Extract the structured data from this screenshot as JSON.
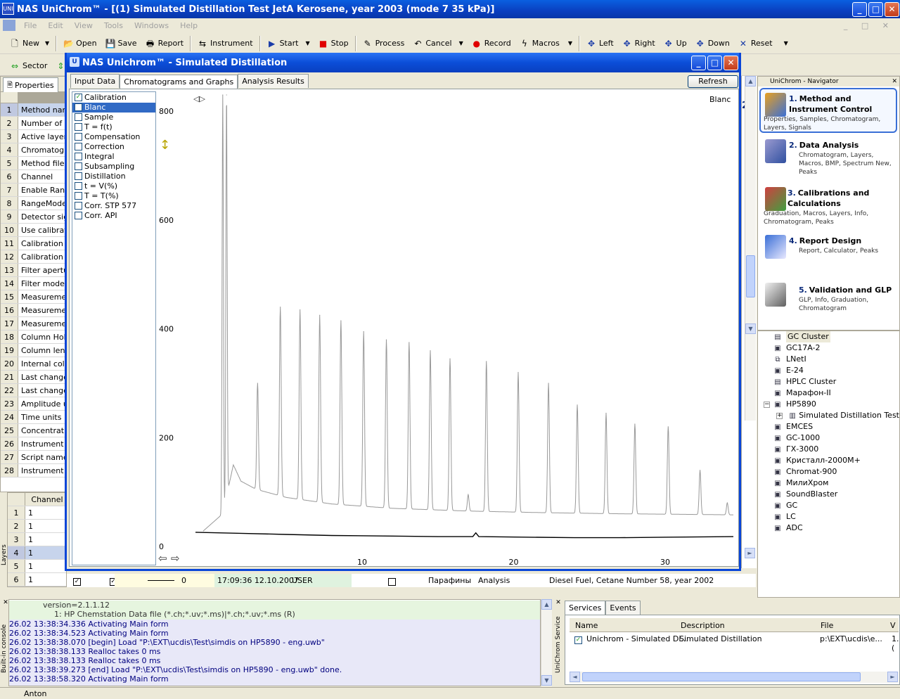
{
  "window": {
    "title": "NAS UniChrom™ - [(1) Simulated Distillation Test JetA Kerosene, year 2003 (mode 7 35 kPa)]",
    "icon_text": "UNI"
  },
  "menu": [
    "File",
    "Edit",
    "View",
    "Tools",
    "Windows",
    "Help"
  ],
  "toolbar1": {
    "new": "New",
    "open": "Open",
    "save": "Save",
    "report": "Report",
    "instrument": "Instrument",
    "start": "Start",
    "stop": "Stop",
    "process": "Process",
    "cancel": "Cancel",
    "record": "Record",
    "macros": "Macros",
    "left": "Left",
    "right": "Right",
    "up": "Up",
    "down": "Down",
    "reset": "Reset"
  },
  "toolbar2": {
    "sector": "Sector"
  },
  "properties": {
    "tab": "Properties",
    "rows": [
      {
        "n": "1",
        "label": "Method name"
      },
      {
        "n": "2",
        "label": "Number of la"
      },
      {
        "n": "3",
        "label": "Active layer"
      },
      {
        "n": "4",
        "label": "Chromatogra"
      },
      {
        "n": "5",
        "label": "Method file n"
      },
      {
        "n": "6",
        "label": "Channel"
      },
      {
        "n": "7",
        "label": "Enable Rang"
      },
      {
        "n": "8",
        "label": "RangeMode"
      },
      {
        "n": "9",
        "label": "Detector sign"
      },
      {
        "n": "10",
        "label": "Use calibrati"
      },
      {
        "n": "11",
        "label": "Calibration fa"
      },
      {
        "n": "12",
        "label": "Calibration fa"
      },
      {
        "n": "13",
        "label": "Filter apertur"
      },
      {
        "n": "14",
        "label": "Filter mode"
      },
      {
        "n": "15",
        "label": "Measuremen"
      },
      {
        "n": "16",
        "label": "Measuremen"
      },
      {
        "n": "17",
        "label": "Measuremen"
      },
      {
        "n": "18",
        "label": "Column Holde"
      },
      {
        "n": "19",
        "label": "Column lengt"
      },
      {
        "n": "20",
        "label": "Internal colur"
      },
      {
        "n": "21",
        "label": "Last change"
      },
      {
        "n": "22",
        "label": "Last change"
      },
      {
        "n": "23",
        "label": "Amplitude ur"
      },
      {
        "n": "24",
        "label": "Time units"
      },
      {
        "n": "25",
        "label": "Concentratio"
      },
      {
        "n": "26",
        "label": "Instrument"
      },
      {
        "n": "27",
        "label": "Script name"
      },
      {
        "n": "28",
        "label": "Instrument"
      }
    ]
  },
  "layers": {
    "side_label": "Layers",
    "header": "Channel",
    "rows": [
      {
        "n": "1",
        "v": "1"
      },
      {
        "n": "2",
        "v": "1"
      },
      {
        "n": "3",
        "v": "1"
      },
      {
        "n": "4",
        "v": "1"
      },
      {
        "n": "5",
        "v": "1"
      },
      {
        "n": "6",
        "v": "1"
      }
    ],
    "row6": {
      "value": "0",
      "datetime": "17:09:36 12.10.2007",
      "user": "USER",
      "name": "Парафины",
      "type": "Analysis",
      "description": "Diesel Fuel, Cetane Number 58, year 2002"
    }
  },
  "dialog": {
    "title": "NAS Unichrom™ - Simulated Distillation",
    "tabs": [
      "Input Data",
      "Chromatograms and Graphs",
      "Analysis Results"
    ],
    "refresh": "Refresh",
    "list": [
      {
        "label": "Calibration",
        "checked": true
      },
      {
        "label": "Blanc",
        "checked": false
      },
      {
        "label": "Sample",
        "checked": false
      },
      {
        "label": "T = f(t)",
        "checked": false
      },
      {
        "label": "Compensation",
        "checked": false
      },
      {
        "label": "Correction",
        "checked": false
      },
      {
        "label": "Integral",
        "checked": false
      },
      {
        "label": "Subsampling",
        "checked": false
      },
      {
        "label": "Distillation",
        "checked": false
      },
      {
        "label": "t  = V(%)",
        "checked": false
      },
      {
        "label": "T = T(%)",
        "checked": false
      },
      {
        "label": "Corr. STP 577",
        "checked": false
      },
      {
        "label": "Corr. API",
        "checked": false
      }
    ]
  },
  "chart_data": {
    "type": "line",
    "title": "",
    "legend": "Blanc",
    "xlabel": "",
    "ylabel": "",
    "xlim": [
      -1,
      34.5
    ],
    "ylim": [
      0,
      830
    ],
    "x_ticks": [
      10,
      20,
      30
    ],
    "y_ticks": [
      0,
      200,
      400,
      600,
      800
    ],
    "colors": {
      "calibration": "#999999",
      "baseline": "#000000"
    },
    "series": [
      {
        "name": "",
        "style": "calibration",
        "baseline": [
          [
            -0.5,
            28
          ],
          [
            0.8,
            60
          ],
          [
            1.5,
            150
          ],
          [
            2,
            120
          ],
          [
            3,
            105
          ],
          [
            5,
            90
          ],
          [
            8,
            78
          ],
          [
            12,
            70
          ],
          [
            17,
            65
          ],
          [
            22,
            62
          ],
          [
            27,
            60
          ],
          [
            31,
            59
          ],
          [
            34.5,
            58
          ]
        ],
        "peaks": [
          [
            0.8,
            830
          ],
          [
            1.05,
            830
          ],
          [
            3.1,
            300
          ],
          [
            4.6,
            440
          ],
          [
            5.9,
            435
          ],
          [
            7.2,
            425
          ],
          [
            8.6,
            415
          ],
          [
            10.1,
            395
          ],
          [
            11.6,
            380
          ],
          [
            13.1,
            375
          ],
          [
            14.5,
            360
          ],
          [
            15.8,
            345
          ],
          [
            17.0,
            95
          ],
          [
            18.2,
            340
          ],
          [
            20.3,
            320
          ],
          [
            22.3,
            300
          ],
          [
            24.2,
            260
          ],
          [
            26.1,
            245
          ],
          [
            28.0,
            225
          ],
          [
            30.2,
            220
          ],
          [
            32.3,
            140
          ],
          [
            34.1,
            80
          ]
        ]
      },
      {
        "name": "",
        "style": "baseline",
        "points": [
          [
            -1,
            26
          ],
          [
            2,
            24
          ],
          [
            5,
            22
          ],
          [
            8,
            20
          ],
          [
            12,
            19
          ],
          [
            15,
            18
          ],
          [
            17.3,
            18
          ],
          [
            17.5,
            25
          ],
          [
            17.7,
            18
          ],
          [
            21,
            17
          ],
          [
            24,
            16
          ],
          [
            27,
            16
          ],
          [
            30,
            17
          ],
          [
            34.5,
            18
          ]
        ]
      }
    ]
  },
  "navigator": {
    "title": "UniChrom - Navigator",
    "items": [
      {
        "num": "1.",
        "title": "Method and Instrument Control",
        "sub": "Properties, Samples, Chromatogram, Layers, Signals"
      },
      {
        "num": "2.",
        "title": "Data Analysis",
        "sub": "Chromatogram, Layers, Macros, BMP, Spectrum New, Peaks"
      },
      {
        "num": "3.",
        "title": "Calibrations and Calculations",
        "sub": "Graduation, Macros, Layers, Info, Chromatogram, Peaks"
      },
      {
        "num": "4.",
        "title": "Report Design",
        "sub": "Report, Calculator, Peaks"
      },
      {
        "num": "5.",
        "title": "Validation and GLP",
        "sub": "GLP, Info, Graduation, Chromatogram"
      }
    ]
  },
  "tree": [
    {
      "label": "GC Cluster",
      "icon": "cluster-icon",
      "level": 0
    },
    {
      "label": "GC17A-2",
      "icon": "device-icon",
      "level": 0
    },
    {
      "label": "LNetI",
      "icon": "lnet-icon",
      "level": 0
    },
    {
      "label": "E-24",
      "icon": "device-icon",
      "level": 0
    },
    {
      "label": "HPLC Cluster",
      "icon": "cluster-icon",
      "level": 0
    },
    {
      "label": "Марафон-II",
      "icon": "device-icon",
      "level": 0
    },
    {
      "label": "HP5890",
      "icon": "device-icon",
      "level": 0
    },
    {
      "label": "Simulated Distillation Test",
      "icon": "chart-icon",
      "level": 1
    },
    {
      "label": "EMCES",
      "icon": "device-icon",
      "level": 0
    },
    {
      "label": "GC-1000",
      "icon": "device-icon",
      "level": 0
    },
    {
      "label": "ГХ-3000",
      "icon": "device-icon",
      "level": 0
    },
    {
      "label": "Кристалл-2000М+",
      "icon": "device-icon",
      "level": 0
    },
    {
      "label": "Chromat-900",
      "icon": "device-icon",
      "level": 0
    },
    {
      "label": "МилиХром",
      "icon": "device-icon",
      "level": 0
    },
    {
      "label": "SoundBlaster",
      "icon": "device-icon",
      "level": 0
    },
    {
      "label": "GC",
      "icon": "device-icon",
      "level": 0
    },
    {
      "label": "LC",
      "icon": "device-icon",
      "level": 0
    },
    {
      "label": "ADC",
      "icon": "device-icon",
      "level": 0
    }
  ],
  "console": {
    "side_label": "Built-in console",
    "lines": [
      "version=2.1.1.12",
      "1: HP Chemstation Data file (*.ch;*.uv;*.ms)|*.ch;*.uv;*.ms (R)",
      "26.02 13:38:34.336 Activating Main form",
      "26.02 13:38:34.523 Activating Main form",
      "26.02 13:38:38.070 [begin] Load \"P:\\EXT\\ucdis\\Test\\simdis on HP5890 - eng.uwb\"",
      "26.02 13:38:38.133 Realloc takes 0 ms",
      "26.02 13:38:38.133 Realloc takes 0 ms",
      "26.02 13:38:39.273 [end] Load \"P:\\EXT\\ucdis\\Test\\simdis on HP5890 - eng.uwb\" done.",
      "26.02 13:38:58.320 Activating Main form"
    ]
  },
  "services": {
    "side_label": "UniChrom Service",
    "tabs": [
      "Services",
      "Events"
    ],
    "columns": [
      "Name",
      "Description",
      "File",
      "V"
    ],
    "rows": [
      {
        "name": "Unichrom - Simulated Di...",
        "description": "Simulated Distillation",
        "file": "p:\\EXT\\ucdis\\e...",
        "v": "1.("
      }
    ]
  },
  "statusbar": {
    "user": "Anton"
  },
  "misc": {
    "year_fragment": "20"
  }
}
